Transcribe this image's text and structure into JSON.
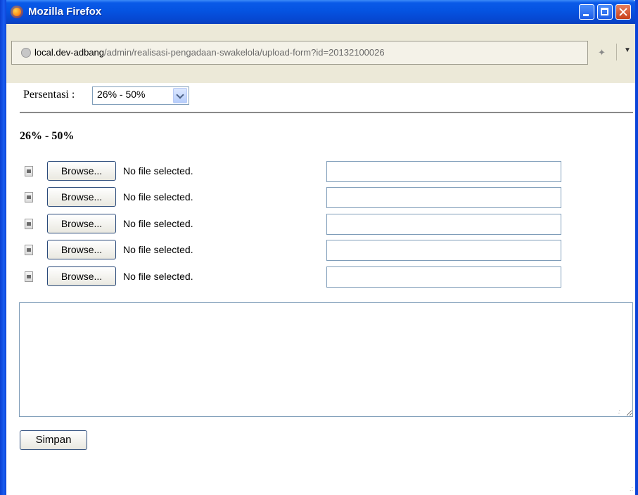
{
  "window": {
    "title": "Mozilla Firefox"
  },
  "location_bar": {
    "url_domain": "local.dev-adbang",
    "url_path": "/admin/realisasi-pengadaan-swakelola/upload-form?id=20132100026"
  },
  "form": {
    "persentasi_label": "Persentasi :",
    "persentasi_selected": "26% - 50%",
    "section_heading": "26% - 50%",
    "file_rows": [
      {
        "browse_label": "Browse...",
        "status": "No file selected.",
        "caption": ""
      },
      {
        "browse_label": "Browse...",
        "status": "No file selected.",
        "caption": ""
      },
      {
        "browse_label": "Browse...",
        "status": "No file selected.",
        "caption": ""
      },
      {
        "browse_label": "Browse...",
        "status": "No file selected.",
        "caption": ""
      },
      {
        "browse_label": "Browse...",
        "status": "No file selected.",
        "caption": ""
      }
    ],
    "notes_value": "",
    "submit_label": "Simpan"
  }
}
